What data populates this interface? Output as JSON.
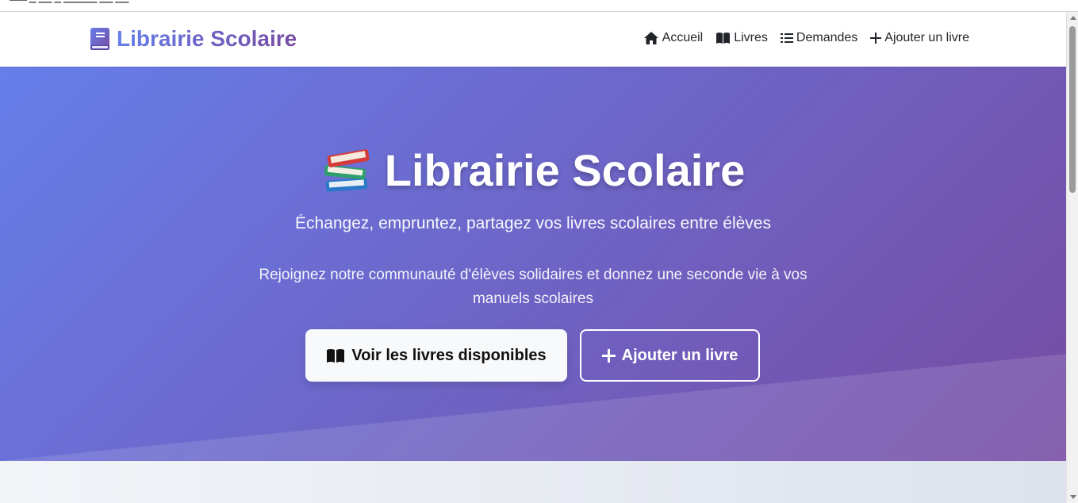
{
  "navbar": {
    "brand": "Librairie Scolaire",
    "links": [
      {
        "label": "Accueil",
        "icon": "home-icon"
      },
      {
        "label": "Livres",
        "icon": "open-book-icon"
      },
      {
        "label": "Demandes",
        "icon": "list-icon"
      },
      {
        "label": "Ajouter un livre",
        "icon": "plus-icon"
      }
    ]
  },
  "hero": {
    "title": "Librairie Scolaire",
    "title_icon": "books-stack-icon",
    "subtitle": "Échangez, empruntez, partagez vos livres scolaires entre élèves",
    "description": "Rejoignez notre communauté d'élèves solidaires et donnez une seconde vie à vos manuels scolaires",
    "primary_button": "Voir les livres disponibles",
    "secondary_button": "Ajouter un livre"
  },
  "colors": {
    "gradient_start": "#667eea",
    "gradient_end": "#764ba2",
    "brand": "#6f5bc5"
  }
}
